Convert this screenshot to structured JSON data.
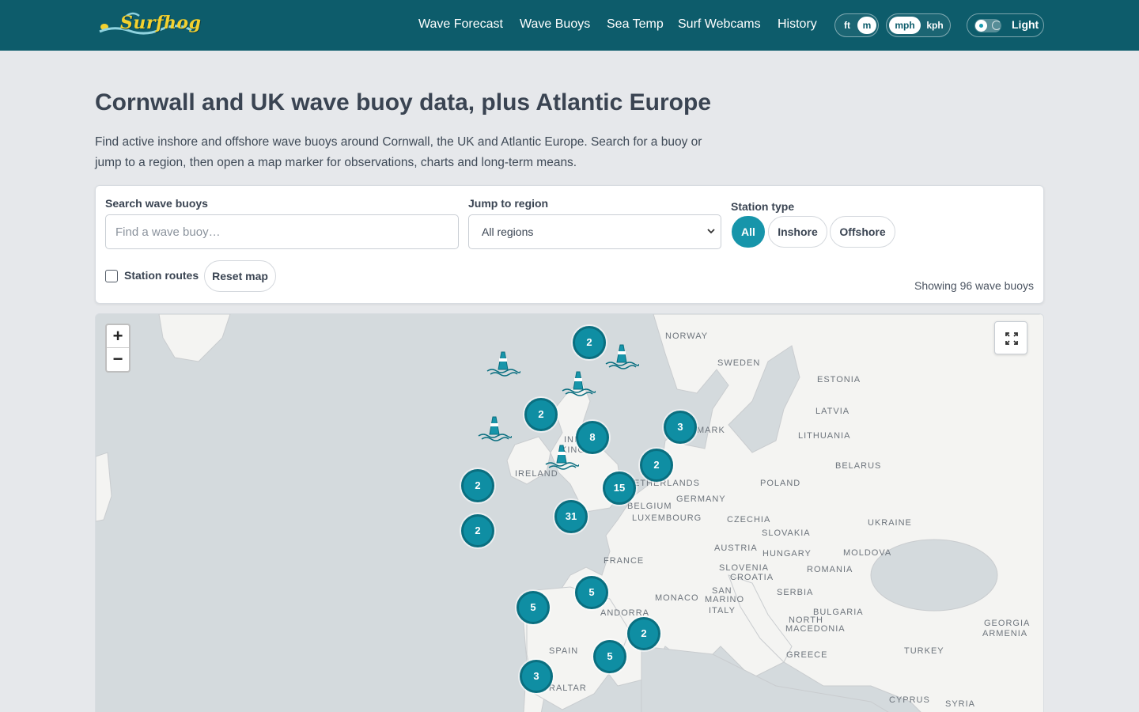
{
  "brand": {
    "name": "Surfhog"
  },
  "nav": [
    {
      "id": "forecast",
      "label": "Wave Forecast"
    },
    {
      "id": "buoys",
      "label": "Wave Buoys"
    },
    {
      "id": "seatemp",
      "label": "Sea Temp"
    },
    {
      "id": "webcams",
      "label": "Surf Webcams"
    },
    {
      "id": "history",
      "label": "History"
    }
  ],
  "units": {
    "height": {
      "options": [
        "ft",
        "m"
      ],
      "selected": "m"
    },
    "speed": {
      "options": [
        "mph",
        "kph"
      ],
      "selected": "mph"
    }
  },
  "theme": {
    "label": "Light"
  },
  "page": {
    "title": "Cornwall and UK wave buoy data, plus Atlantic Europe",
    "intro": "Find active inshore and offshore wave buoys around Cornwall, the UK and Atlantic Europe. Search for a buoy or jump to a region, then open a map marker for observations, charts and long-term means."
  },
  "filters": {
    "search": {
      "label": "Search wave buoys",
      "placeholder": "Find a wave buoy…",
      "value": ""
    },
    "region": {
      "label": "Jump to region",
      "value": "All regions"
    },
    "station_type": {
      "label": "Station type",
      "options": [
        "All",
        "Inshore",
        "Offshore"
      ],
      "selected": "All"
    },
    "routes": {
      "label": "Station routes",
      "checked": false
    },
    "reset_label": "Reset map",
    "count_text": "Showing 96 wave buoys"
  },
  "map": {
    "zoom_in": "+",
    "zoom_out": "−",
    "clusters": [
      2,
      2,
      8,
      3,
      2,
      15,
      2,
      31,
      2,
      5,
      5,
      2,
      5,
      3
    ],
    "places": [
      "NORWAY",
      "SWEDEN",
      "ESTONIA",
      "LATVIA",
      "MARK",
      "LITHUANIA",
      "INI",
      "KINGD",
      "IRELAND",
      "BELARUS",
      "ETHERLANDS",
      "POLAND",
      "GERMANY",
      "BELGIUM",
      "LUXEMBOURG",
      "CZECHIA",
      "UKRAINE",
      "SLOVAKIA",
      "AUSTRIA",
      "HUNGARY",
      "MOLDOVA",
      "FRANCE",
      "SLOVENIA",
      "ROMANIA",
      "CROATIA",
      "SAN",
      "MARINO",
      "SERBIA",
      "MONACO",
      "ITALY",
      "BULGARIA",
      "ANDORRA",
      "NORTH",
      "MACEDONIA",
      "GEORGIA",
      "ARMENIA",
      "SPAIN",
      "GREECE",
      "TURKEY",
      "RALTAR",
      "CYPRUS",
      "SYRIA"
    ]
  },
  "colors": {
    "header": "#0d5c6b",
    "accent": "#1795aa",
    "cluster": "#0f8ea3"
  }
}
